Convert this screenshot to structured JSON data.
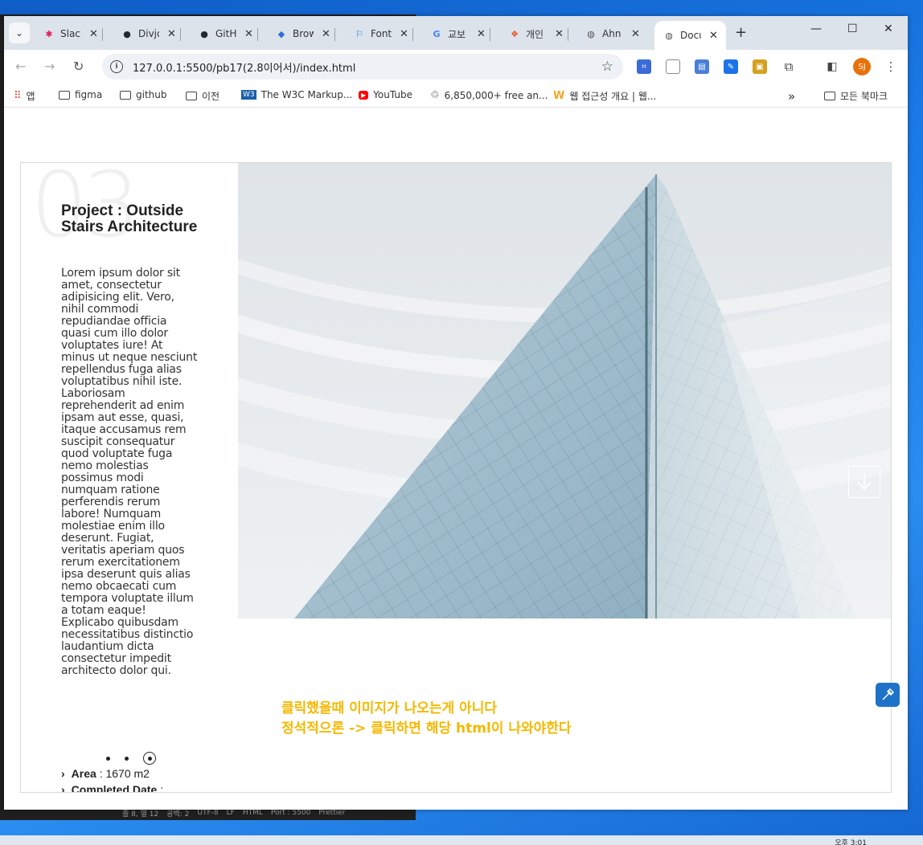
{
  "browser": {
    "tabs": [
      {
        "label": "Slack",
        "icon": "slack-icon",
        "color": "#e01e5a"
      },
      {
        "label": "Divjoy",
        "icon": "github-icon",
        "color": "#24292f"
      },
      {
        "label": "GitHub",
        "icon": "github-icon",
        "color": "#24292f"
      },
      {
        "label": "Browse",
        "icon": "behance-icon",
        "color": "#2b6fd6"
      },
      {
        "label": "Font",
        "icon": "flag-icon",
        "color": "#1a73e8"
      },
      {
        "label": "교보",
        "icon": "google-icon",
        "color": "#4285f4"
      },
      {
        "label": "개인",
        "icon": "figma-icon",
        "color": "#f24e1e"
      },
      {
        "label": "Ahn",
        "icon": "globe-icon",
        "color": "#555555"
      },
      {
        "label": "Docu",
        "icon": "globe-icon",
        "color": "#555555",
        "active": true
      }
    ],
    "url": "127.0.0.1:5500/pb17(2.8이어서)/index.html",
    "avatar_initials": "SJ",
    "bookmarks": [
      {
        "label": "앱",
        "icon": "apps-grid-icon"
      },
      {
        "label": "figma",
        "icon": "folder-icon"
      },
      {
        "label": "github",
        "icon": "folder-icon"
      },
      {
        "label": "이전",
        "icon": "folder-icon"
      },
      {
        "label": "The W3C Markup...",
        "icon": "w3c-icon"
      },
      {
        "label": "YouTube",
        "icon": "youtube-icon"
      },
      {
        "label": "6,850,000+ free an...",
        "icon": "recycle-icon"
      },
      {
        "label": "웹 접근성 개요 | 웹...",
        "icon": "w-logo-icon"
      }
    ],
    "more_bookmarks": "»",
    "all_bookmarks": "모든 북마크"
  },
  "project": {
    "number": "03",
    "title": "Project : Outside Stairs Architecture",
    "description": "Lorem ipsum dolor sit amet, consectetur adipisicing elit. Vero, nihil commodi repudiandae officia quasi cum illo dolor voluptates iure! At minus ut neque nesciunt repellendus fuga alias voluptatibus nihil iste. Laboriosam reprehenderit ad enim ipsam aut esse, quasi, itaque accusamus rem suscipit consequatur quod voluptate fuga nemo molestias possimus modi numquam ratione perferendis rerum labore! Numquam molestiae enim illo deserunt. Fugiat, veritatis aperiam quos rerum exercitationem ipsa deserunt quis alias nemo obcaecati cum tempora voluptate illum a totam eaque! Explicabo quibusdam necessitatibus distinctio laudantium dicta consectetur impedit architecto dolor qui.",
    "area_label": "Area",
    "area_value": " : 1670 m2",
    "completed_label": "Completed Date",
    "completed_value": " :",
    "slide_count": 3,
    "active_slide": 3
  },
  "notes": {
    "line1": "클릭했을때 이미지가 나오는게 아니다",
    "line2": "정석적으론 -> 클릭하면 해당 html이 나와야한다"
  },
  "editor_status": [
    "줄 8, 열 12",
    "공백: 2",
    "UTF-8",
    "LF",
    "HTML",
    "Port : 5500",
    "Prettier"
  ],
  "taskbar": {
    "clock": "오후 3:01"
  }
}
